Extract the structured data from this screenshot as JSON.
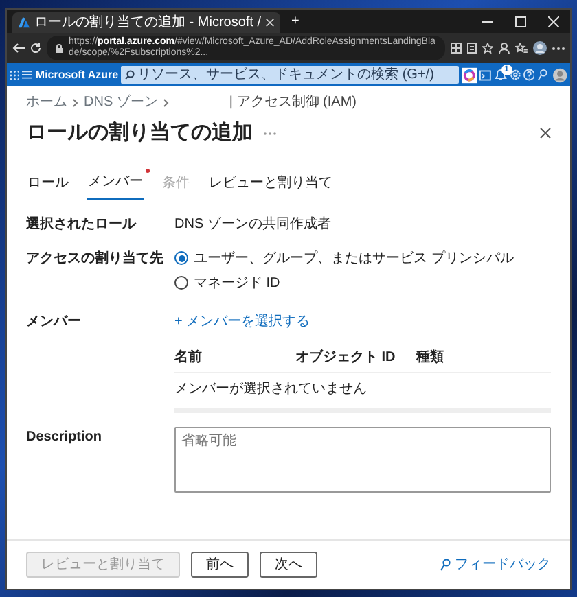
{
  "browser": {
    "tab_title": "ロールの割り当ての追加 - Microsoft /",
    "new_tab": "+",
    "url": "https://**portal.azure.com**/#view/Microsoft_Azure_AD/AddRoleAssignmentsLandingBlade/scope/%2Fsubscriptions%2..."
  },
  "portal": {
    "brand": "Microsoft Azure",
    "search": {
      "placeholder": "リソース、サービス、ドキュメントの検索 (G+/)"
    },
    "notification_count": "1"
  },
  "breadcrumb": [
    {
      "label": "ホーム"
    },
    {
      "label": "DNS ゾーン"
    }
  ],
  "breadcrumb_tail": "| アクセス制御 (IAM)",
  "title": "ロールの割り当ての追加",
  "tabs": [
    {
      "label": "ロール",
      "selected": false,
      "disabled": false,
      "required": false
    },
    {
      "label": "メンバー",
      "selected": true,
      "disabled": false,
      "required": true
    },
    {
      "label": "条件",
      "selected": false,
      "disabled": true,
      "required": false
    },
    {
      "label": "レビューと割り当て",
      "selected": false,
      "disabled": false,
      "required": false
    }
  ],
  "selected_role": {
    "label": "選択されたロール",
    "value": "DNS ゾーンの共同作成者"
  },
  "assign_access_to": {
    "label": "アクセスの割り当て先",
    "options": [
      {
        "label": "ユーザー、グループ、またはサービス プリンシパル",
        "selected": true
      },
      {
        "label": "マネージド ID",
        "selected": false
      }
    ]
  },
  "members": {
    "label": "メンバー",
    "link": "+ メンバーを選択する"
  },
  "members_table": {
    "columns": [
      "名前",
      "オブジェクト ID",
      "種類"
    ],
    "empty_message": "メンバーが選択されていません"
  },
  "description": {
    "label": "Description",
    "placeholder": "省略可能"
  },
  "footer": {
    "buttons": [
      {
        "label": "レビューと割り当て",
        "disabled": true
      },
      {
        "label": "前へ",
        "disabled": false
      },
      {
        "label": "次へ",
        "disabled": false
      }
    ],
    "feedback": "フィードバック"
  }
}
